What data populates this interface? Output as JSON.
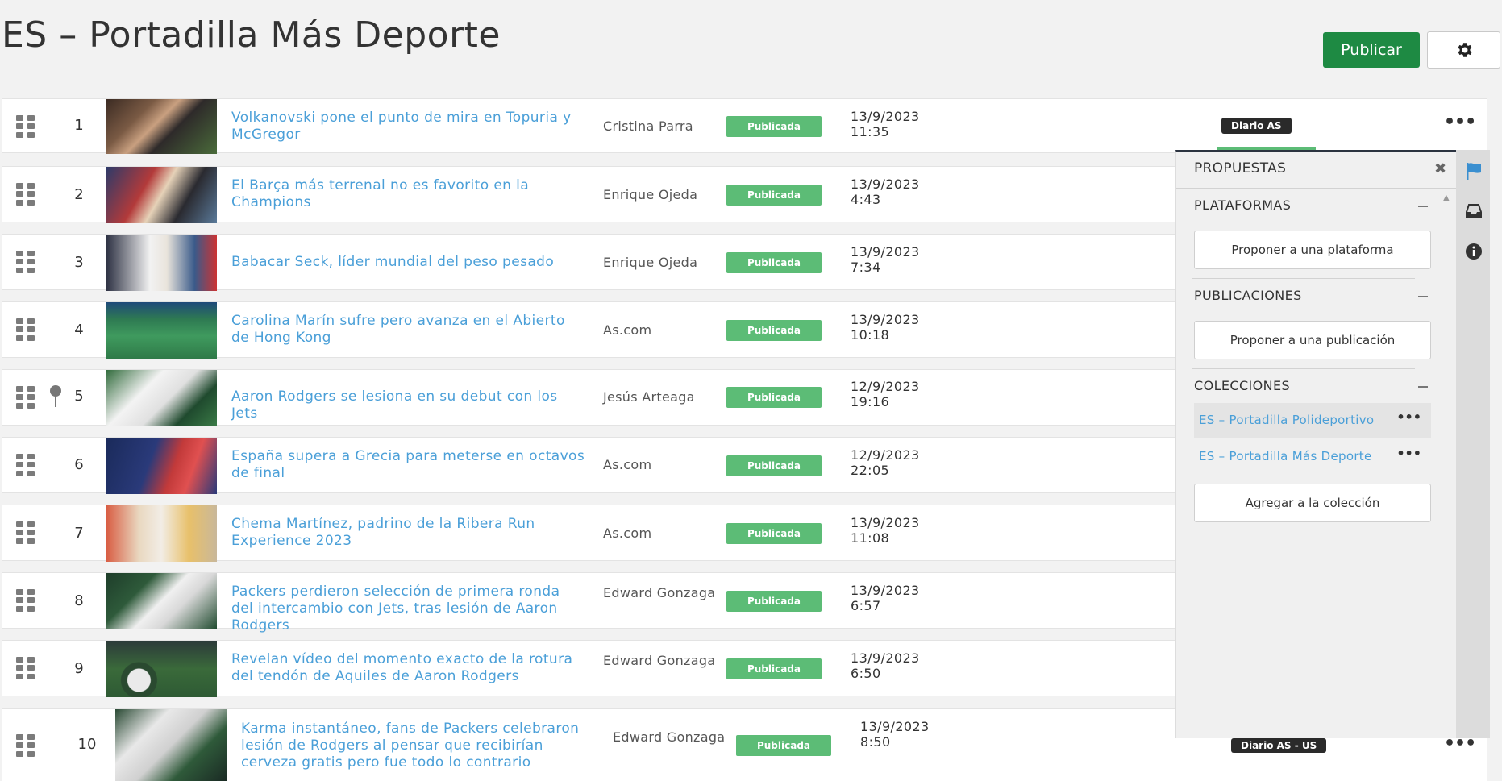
{
  "header": {
    "title": "ES – Portadilla Más Deporte",
    "publish_label": "Publicar",
    "settings_icon": "gear-icon"
  },
  "articles": [
    {
      "index": "1",
      "title": "Volkanovski pone el punto de mira en Topuria y McGregor",
      "author": "Cristina Parra",
      "status": "Publicada",
      "date": "13/9/2023",
      "time": "11:35"
    },
    {
      "index": "2",
      "title": "El Barça más terrenal no es favorito en la Champions",
      "author": "Enrique Ojeda",
      "status": "Publicada",
      "date": "13/9/2023",
      "time": "4:43"
    },
    {
      "index": "3",
      "title": "Babacar Seck, líder mundial del peso pesado",
      "author": "Enrique Ojeda",
      "status": "Publicada",
      "date": "13/9/2023",
      "time": "7:34"
    },
    {
      "index": "4",
      "title": "Carolina Marín sufre pero avanza en el Abierto de Hong Kong",
      "author": "As.com",
      "status": "Publicada",
      "date": "13/9/2023",
      "time": "10:18"
    },
    {
      "index": "5",
      "title": "Aaron Rodgers se lesiona en su debut con los Jets",
      "author": "Jesús Arteaga",
      "status": "Publicada",
      "date": "12/9/2023",
      "time": "19:16"
    },
    {
      "index": "6",
      "title": "España supera a Grecia para meterse en octavos de final",
      "author": "As.com",
      "status": "Publicada",
      "date": "12/9/2023",
      "time": "22:05"
    },
    {
      "index": "7",
      "title": "Chema Martínez, padrino de la Ribera Run Experience 2023",
      "author": "As.com",
      "status": "Publicada",
      "date": "13/9/2023",
      "time": "11:08"
    },
    {
      "index": "8",
      "title": "Packers perdieron selección de primera ronda del intercambio con Jets, tras lesión de Aaron Rodgers",
      "author": "Edward Gonzaga",
      "status": "Publicada",
      "date": "13/9/2023",
      "time": "6:57"
    },
    {
      "index": "9",
      "title": "Revelan vídeo del momento exacto de la rotura del tendón de Aquiles de Aaron Rodgers",
      "author": "Edward Gonzaga",
      "status": "Publicada",
      "date": "13/9/2023",
      "time": "6:50"
    },
    {
      "index": "10",
      "title": "Karma instantáneo, fans de Packers celebraron lesión de Rodgers al pensar que recibirían cerveza gratis pero fue todo lo contrario",
      "author": "Edward Gonzaga",
      "status": "Publicada",
      "date": "13/9/2023",
      "time": "8:50"
    }
  ],
  "badges": {
    "row1": "Diario AS",
    "row10": "Diario AS - US"
  },
  "panel": {
    "title": "PROPUESTAS",
    "platforms_label": "PLATAFORMAS",
    "propose_platform": "Proponer a una plataforma",
    "publications_label": "PUBLICACIONES",
    "propose_publication": "Proponer a una publicación",
    "collections_label": "COLECCIONES",
    "collections": [
      {
        "label": "ES – Portadilla Polideportivo",
        "selected": true
      },
      {
        "label": "ES – Portadilla Más Deporte",
        "selected": false
      }
    ],
    "add_collection": "Agregar a la colección"
  },
  "colors": {
    "accent": "#1e8a43",
    "link": "#4a9fd8",
    "status_published": "#5cbc76"
  }
}
